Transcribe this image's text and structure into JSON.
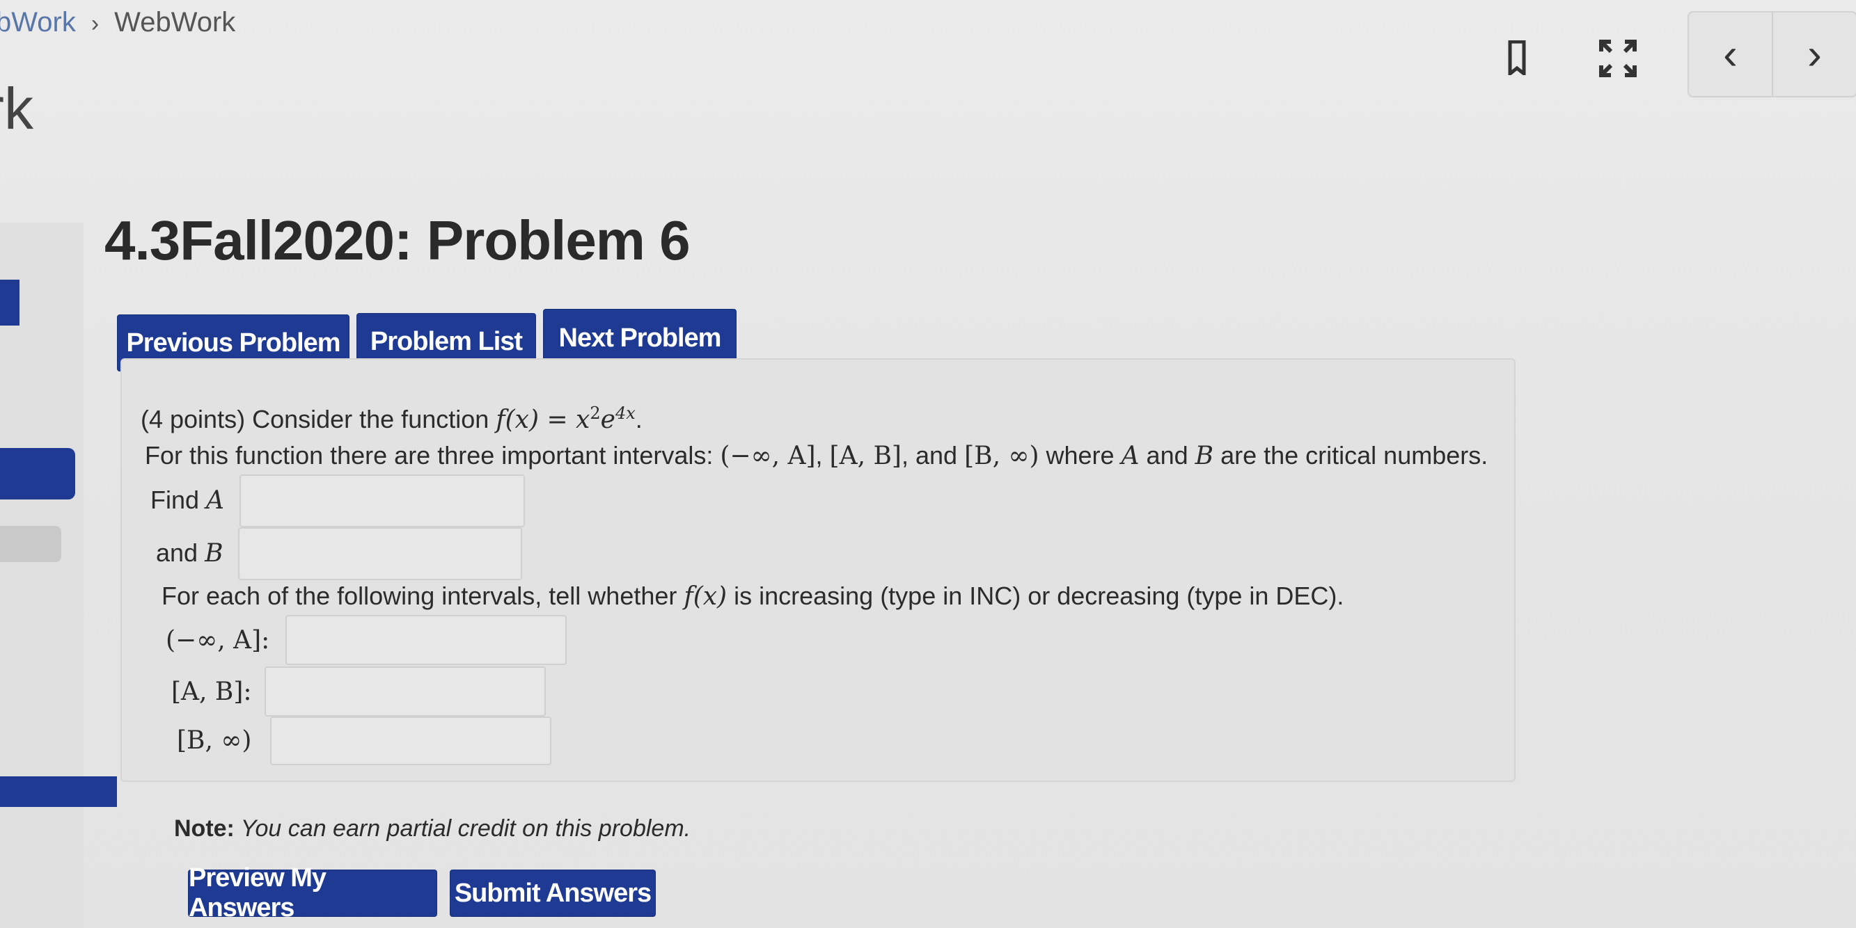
{
  "breadcrumb": {
    "parent": "bWork",
    "separator": "›",
    "current": "WebWork"
  },
  "site_title": "rk",
  "toolbar": {
    "prev_icon": "‹",
    "next_icon": "›",
    "bookmark_icon": "bookmark-icon",
    "fullscreen_icon": "expand-icon"
  },
  "problem": {
    "title": "4.3Fall2020: Problem 6",
    "nav": {
      "previous": "Previous Problem",
      "list": "Problem List",
      "next": "Next Problem"
    },
    "intro_prefix": "(4 points) Consider the function ",
    "function_lhs": "f(x) = x",
    "function_exp1": "2",
    "function_base2": "e",
    "function_exp2": "4x",
    "function_end": ".",
    "intervals_text_1": "For this function there are three important intervals: ",
    "interval_1": "(−∞, A]",
    "interval_2": "[A, B]",
    "interval_sep": ", ",
    "and_word": ", and ",
    "interval_3": "[B, ∞)",
    "intervals_text_2": " where ",
    "var_a": "A",
    "and_text": " and ",
    "var_b": "B",
    "intervals_text_3": " are the critical numbers.",
    "find_a_label": "Find ",
    "find_a_var": "A",
    "and_b_label": "and ",
    "and_b_var": "B",
    "instructions_1": "For each of the following intervals, tell whether ",
    "instructions_fx": "f(x)",
    "instructions_2": " is increasing (type in INC) or decreasing (type in DEC).",
    "row1_label": "(−∞, A]:",
    "row2_label": "[A, B]:",
    "row3_label": "[B, ∞)",
    "inputs": {
      "find_a": "",
      "and_b": "",
      "row1": "",
      "row2": "",
      "row3": ""
    }
  },
  "note": {
    "bold": "Note:",
    "italic": " You can earn partial credit on this problem."
  },
  "actions": {
    "preview": "Preview My Answers",
    "submit": "Submit Answers"
  },
  "colors": {
    "button": "#1f3a93",
    "box": "#e2e2e2"
  }
}
